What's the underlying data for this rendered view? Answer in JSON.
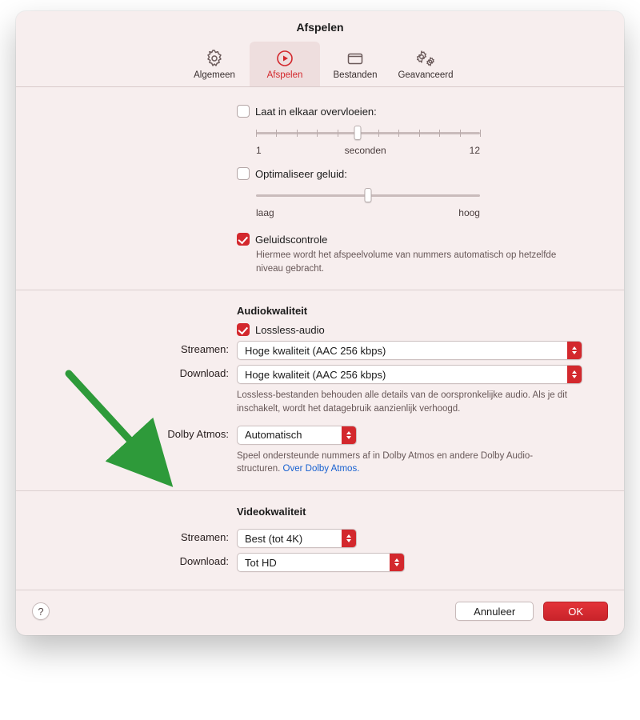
{
  "title": "Afspelen",
  "tabs": [
    {
      "label": "Algemeen"
    },
    {
      "label": "Afspelen"
    },
    {
      "label": "Bestanden"
    },
    {
      "label": "Geavanceerd"
    }
  ],
  "crossfade": {
    "label": "Laat in elkaar overvloeien:",
    "min_label": "1",
    "mid_label": "seconden",
    "max_label": "12"
  },
  "enhancer": {
    "label": "Optimaliseer geluid:",
    "low": "laag",
    "high": "hoog"
  },
  "soundcheck": {
    "label": "Geluidscontrole",
    "help": "Hiermee wordt het afspeelvolume van nummers automatisch op hetzelfde niveau gebracht."
  },
  "audio": {
    "heading": "Audiokwaliteit",
    "lossless_label": "Lossless-audio",
    "stream_label": "Streamen:",
    "stream_value": "Hoge kwaliteit (AAC 256 kbps)",
    "download_label": "Download:",
    "download_value": "Hoge kwaliteit (AAC 256 kbps)",
    "lossless_help": "Lossless-bestanden behouden alle details van de oorspronkelijke audio. Als je dit inschakelt, wordt het datagebruik aanzienlijk verhoogd.",
    "atmos_label": "Dolby Atmos:",
    "atmos_value": "Automatisch",
    "atmos_help": "Speel ondersteunde nummers af in Dolby Atmos en andere Dolby Audio-structuren. ",
    "atmos_link": "Over Dolby Atmos."
  },
  "video": {
    "heading": "Videokwaliteit",
    "stream_label": "Streamen:",
    "stream_value": "Best (tot 4K)",
    "download_label": "Download:",
    "download_value": "Tot HD"
  },
  "buttons": {
    "help": "?",
    "cancel": "Annuleer",
    "ok": "OK"
  }
}
